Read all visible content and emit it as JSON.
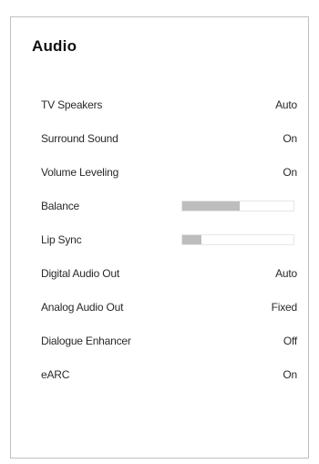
{
  "panel": {
    "title": "Audio",
    "items": [
      {
        "label": "TV Speakers",
        "value": "Auto"
      },
      {
        "label": "Surround Sound",
        "value": "On"
      },
      {
        "label": "Volume Leveling",
        "value": "On"
      },
      {
        "label": "Balance",
        "slider_level": 0.52
      },
      {
        "label": "Lip Sync",
        "slider_level": 0.17
      },
      {
        "label": "Digital Audio Out",
        "value": "Auto"
      },
      {
        "label": "Analog Audio Out",
        "value": "Fixed"
      },
      {
        "label": "Dialogue Enhancer",
        "value": "Off"
      },
      {
        "label": "eARC",
        "value": "On"
      }
    ]
  }
}
